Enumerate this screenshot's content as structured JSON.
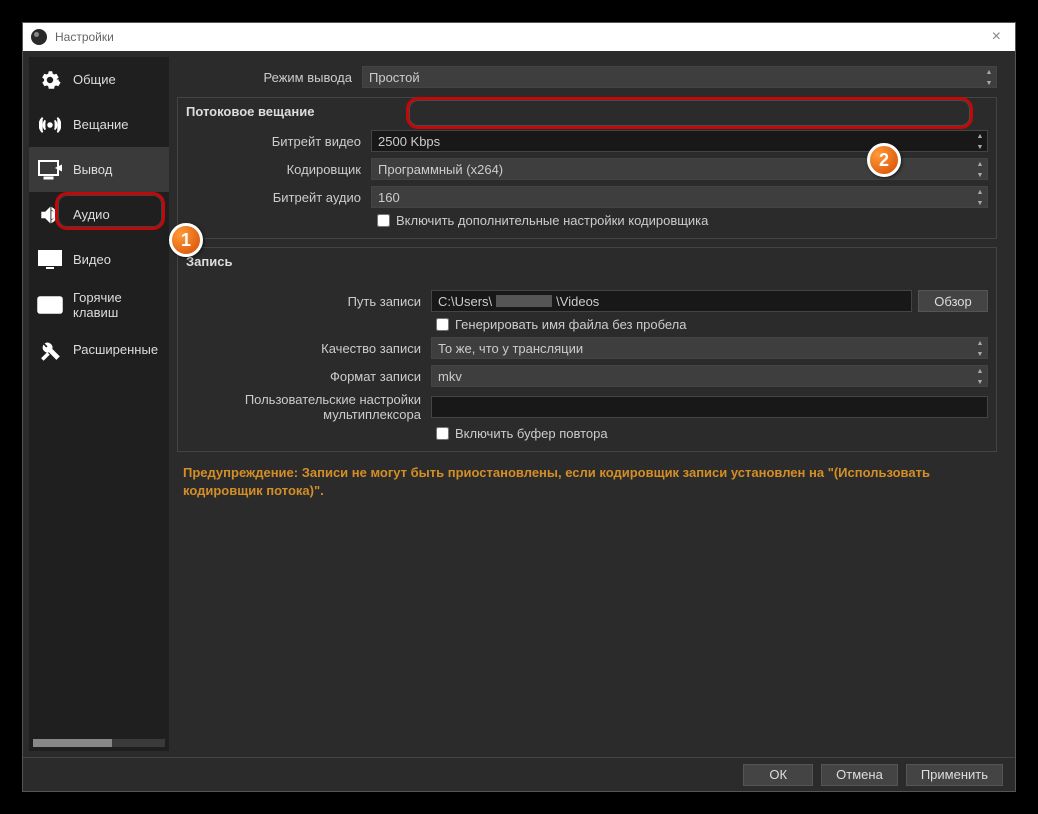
{
  "window": {
    "title": "Настройки"
  },
  "sidebar": {
    "items": [
      {
        "label": "Общие"
      },
      {
        "label": "Вещание"
      },
      {
        "label": "Вывод"
      },
      {
        "label": "Аудио"
      },
      {
        "label": "Видео"
      },
      {
        "label": "Горячие клавиш"
      },
      {
        "label": "Расширенные"
      }
    ]
  },
  "output_mode": {
    "label": "Режим вывода",
    "value": "Простой"
  },
  "streaming": {
    "title": "Потоковое вещание",
    "video_bitrate": {
      "label": "Битрейт видео",
      "value": "2500 Kbps"
    },
    "encoder": {
      "label": "Кодировщик",
      "value": "Программный (x264)"
    },
    "audio_bitrate": {
      "label": "Битрейт аудио",
      "value": "160"
    },
    "advanced_checkbox": "Включить дополнительные настройки кодировщика"
  },
  "recording": {
    "title": "Запись",
    "path": {
      "label": "Путь записи",
      "value_prefix": "C:\\Users\\",
      "value_suffix": "\\Videos",
      "browse": "Обзор"
    },
    "no_space_checkbox": "Генерировать имя файла без пробела",
    "quality": {
      "label": "Качество записи",
      "value": "То же, что у трансляции"
    },
    "format": {
      "label": "Формат записи",
      "value": "mkv"
    },
    "muxer": {
      "label": "Пользовательские настройки мультиплексора",
      "value": ""
    },
    "replay_checkbox": "Включить буфер повтора"
  },
  "warning": "Предупреждение: Записи не могут быть приостановлены, если кодировщик записи установлен на \"(Использовать кодировщик потока)\".",
  "footer": {
    "ok": "ОК",
    "cancel": "Отмена",
    "apply": "Применить"
  }
}
